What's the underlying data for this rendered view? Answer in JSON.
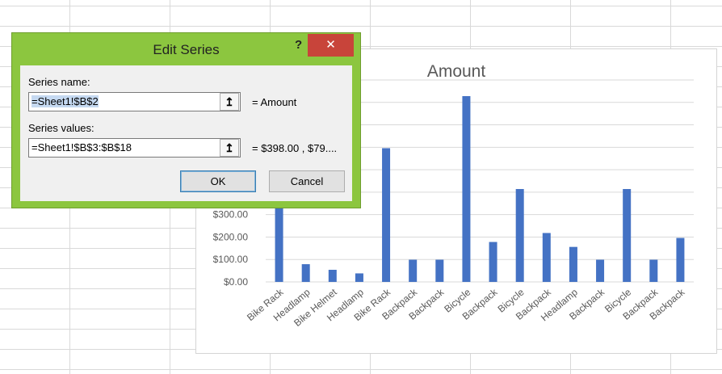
{
  "dialog": {
    "title": "Edit Series",
    "help": "?",
    "close": "✕",
    "series_name_label": "Series name:",
    "series_name_value": "=Sheet1!$B$2",
    "series_name_preview": "= Amount",
    "series_values_label": "Series values:",
    "series_values_value": "=Sheet1!$B$3:$B$18",
    "series_values_preview": "= $398.00 , $79....",
    "ok_label": "OK",
    "cancel_label": "Cancel",
    "collapse_icon": "collapse-dialog-icon"
  },
  "chart_data": {
    "type": "bar",
    "title": "Amount",
    "categories": [
      "Bike Rack",
      "Headlamp",
      "Bike Helmet",
      "Headlamp",
      "Bike Rack",
      "Backpack",
      "Backpack",
      "Bicycle",
      "Backpack",
      "Bicycle",
      "Backpack",
      "Headlamp",
      "Backpack",
      "Bicycle",
      "Backpack",
      "Backpack"
    ],
    "series": [
      {
        "name": "Amount",
        "values": [
          398,
          79,
          54,
          38,
          596,
          99,
          99,
          828,
          178,
          414,
          218,
          156,
          99,
          414,
          99,
          196
        ]
      }
    ],
    "y_tick_labels": [
      "$0.00",
      "$100.00",
      "$200.00",
      "$300.00"
    ],
    "ylim": [
      0,
      900
    ],
    "grid": true,
    "color": "#4472c4"
  }
}
